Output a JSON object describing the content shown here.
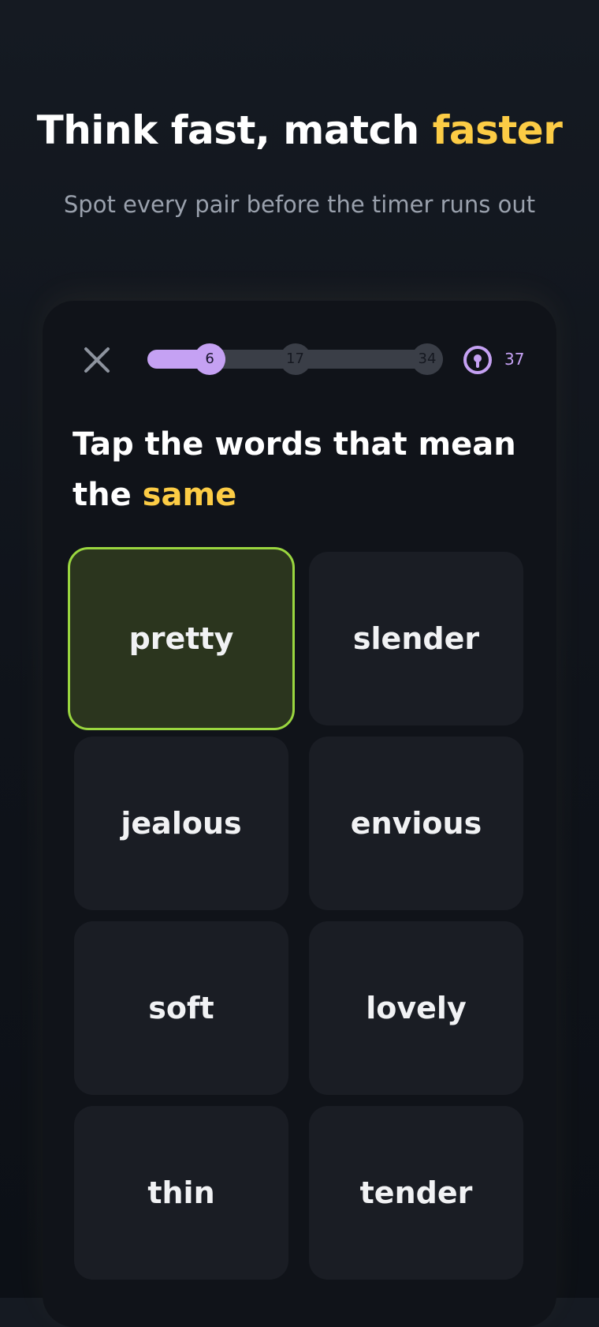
{
  "header": {
    "headline_main": "Think fast, match ",
    "headline_accent": "faster",
    "subtitle": "Spot every pair before the timer runs out"
  },
  "game": {
    "progress": {
      "current": 6,
      "milestones": [
        "6",
        "17",
        "34"
      ],
      "max": 34
    },
    "timer": {
      "icon": "timer-icon",
      "value": "37"
    },
    "prompt_main": "Tap the words that mean the ",
    "prompt_accent": "same",
    "tiles": [
      {
        "word": "pretty",
        "selected": true
      },
      {
        "word": "slender",
        "selected": false
      },
      {
        "word": "jealous",
        "selected": false
      },
      {
        "word": "envious",
        "selected": false
      },
      {
        "word": "soft",
        "selected": false
      },
      {
        "word": "lovely",
        "selected": false
      },
      {
        "word": "thin",
        "selected": false
      },
      {
        "word": "tender",
        "selected": false
      }
    ]
  },
  "colors": {
    "accent_yellow": "#fccc45",
    "progress_purple": "#c5a1f3",
    "selected_border": "#9ad63f",
    "selected_fill": "#2b351e",
    "tile_bg": "#1a1d24"
  }
}
